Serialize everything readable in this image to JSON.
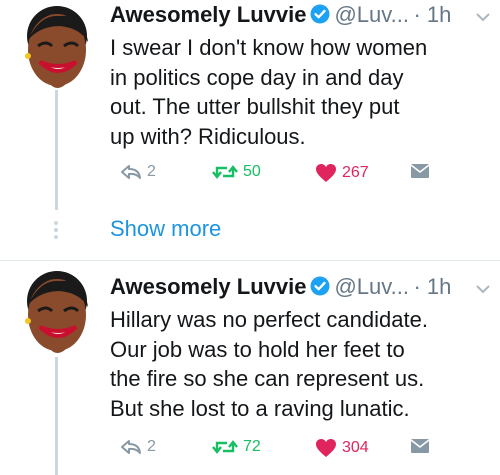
{
  "tweets": [
    {
      "name": "Awesomely Luvvie",
      "handle": "@Luv...",
      "time": "· 1h",
      "text": "I swear I don't know how women\nin politics cope day in and day\nout. The utter bullshit they put\nup with? Ridiculous.",
      "replies": "2",
      "retweets": "50",
      "likes": "267"
    },
    {
      "name": "Awesomely Luvvie",
      "handle": "@Luv...",
      "time": "· 1h",
      "text": "Hillary was no perfect candidate.\nOur job was to hold her feet to\nthe fire so she can represent us.\nBut she lost to a raving lunatic.",
      "replies": "2",
      "retweets": "72",
      "likes": "304"
    }
  ],
  "show_more": "Show more",
  "colors": {
    "verified": "#1da1f2",
    "link": "#1b95e0",
    "retweet": "#17bf63",
    "like": "#e0245e",
    "muted": "#8899a6"
  },
  "icons": [
    "avatar",
    "verified-icon",
    "chevron-down-icon",
    "reply-icon",
    "retweet-icon",
    "heart-icon",
    "direct-message-icon"
  ]
}
